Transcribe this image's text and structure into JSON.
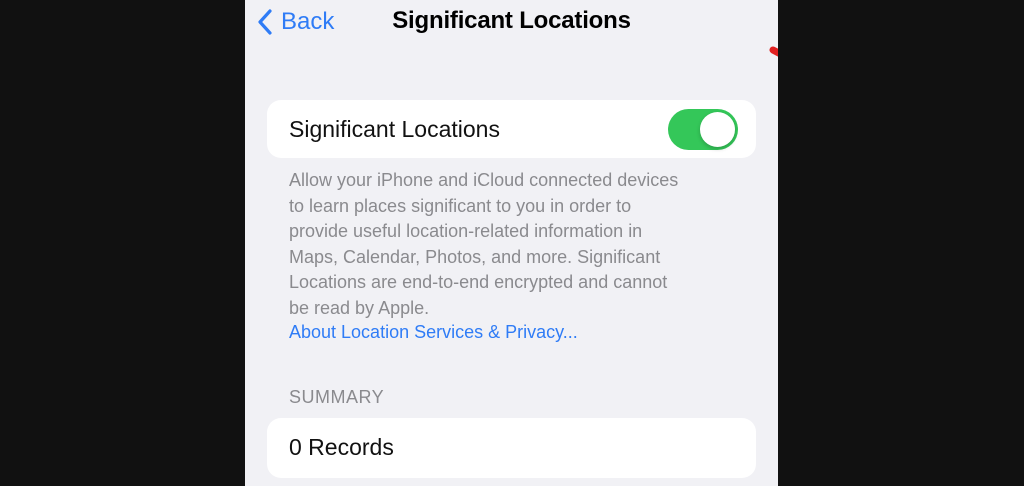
{
  "nav": {
    "back_label": "Back",
    "title": "Significant Locations"
  },
  "toggle": {
    "label": "Significant Locations",
    "state": "on",
    "color": "#34c759"
  },
  "description": {
    "lines": [
      "Allow your iPhone and iCloud connected devices",
      "to learn places significant to you in order to",
      "provide useful location-related information in",
      "Maps, Calendar, Photos, and more. Significant",
      "Locations are end-to-end encrypted and cannot",
      "be read by Apple."
    ],
    "link": "About Location Services & Privacy..."
  },
  "summary": {
    "header": "SUMMARY",
    "records_label": "0 Records"
  },
  "annotation": {
    "arrow_color": "#e02020",
    "icon": "red-arrow-icon"
  },
  "colors": {
    "accent": "#2f7cf6",
    "background": "#f1f1f5",
    "secondary_text": "#8a8a8e"
  }
}
